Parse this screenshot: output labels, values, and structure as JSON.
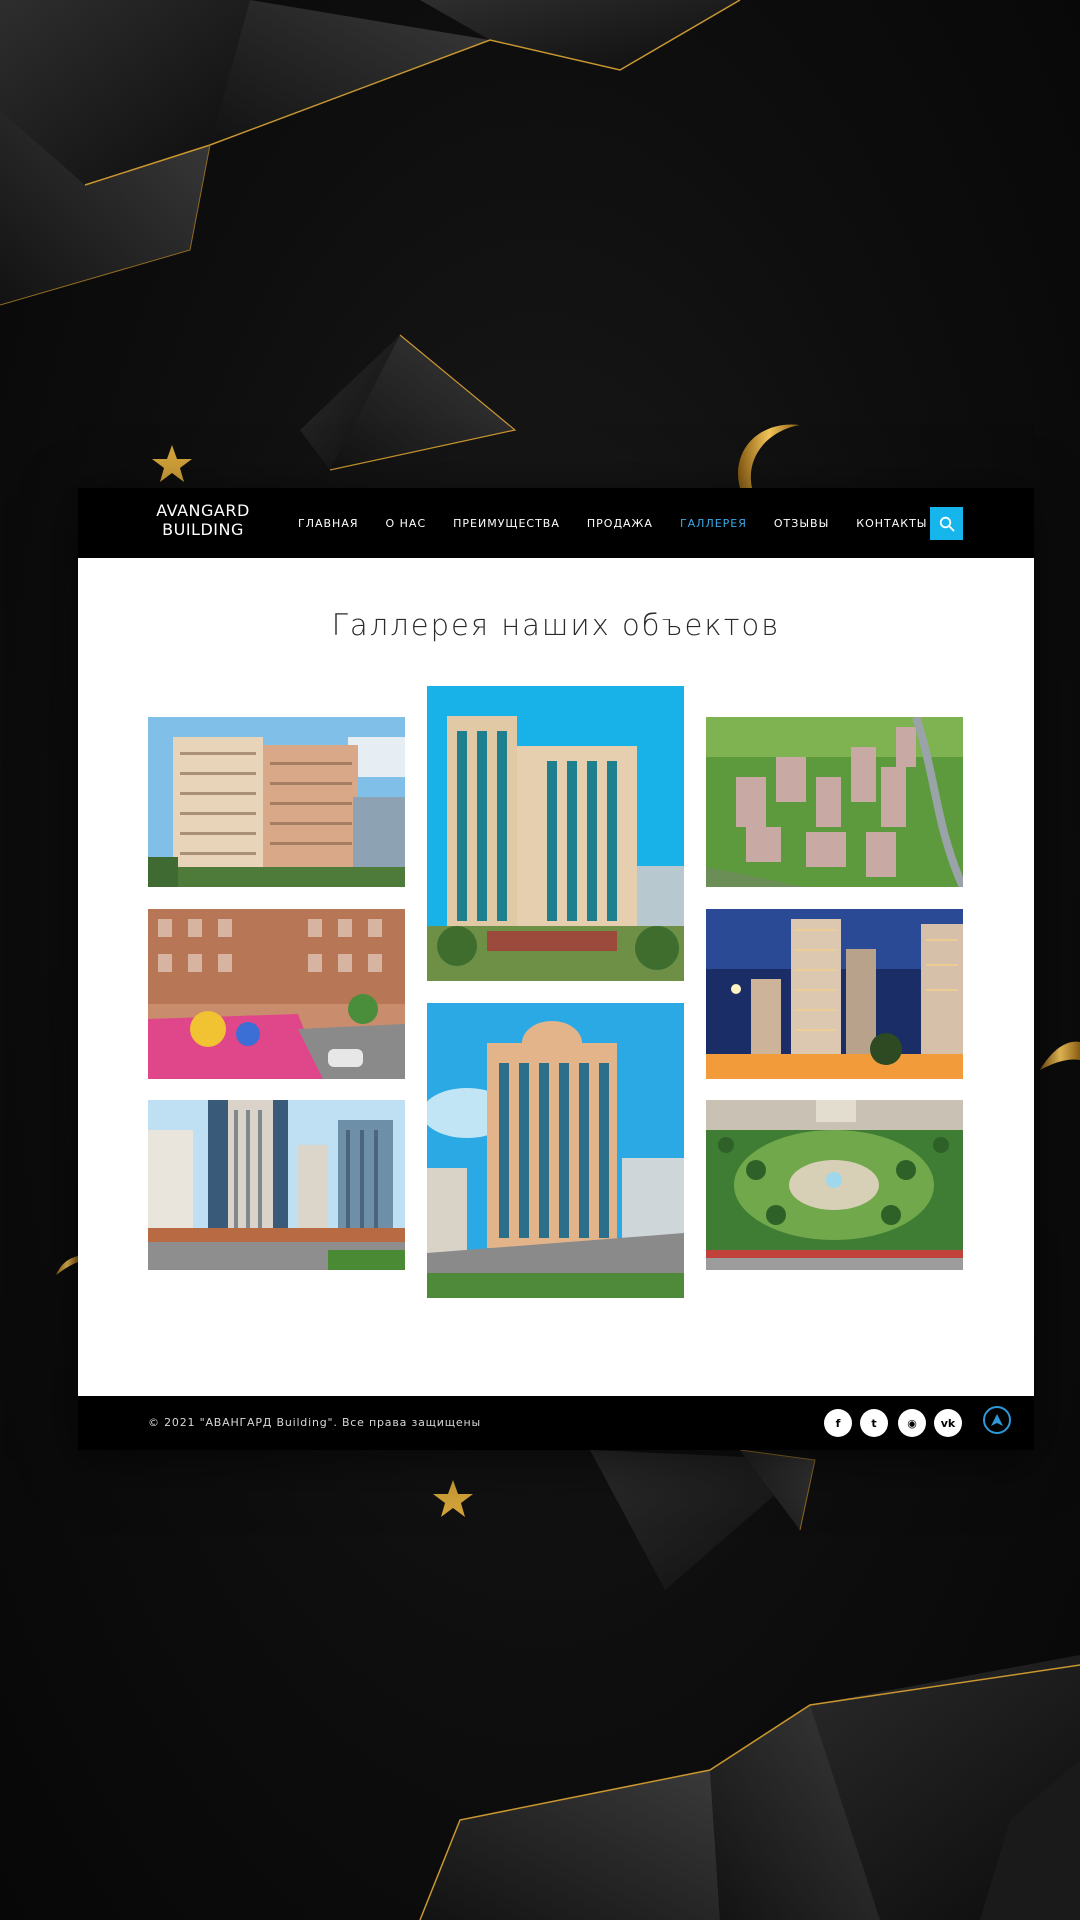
{
  "header": {
    "logo_line1": "AVANGARD",
    "logo_line2": "BUILDING",
    "nav": [
      {
        "label": "ГЛАВНАЯ"
      },
      {
        "label": "О НАС"
      },
      {
        "label": "ПРЕИМУЩЕСТВА"
      },
      {
        "label": "ПРОДАЖА"
      },
      {
        "label": "ГАЛЛЕРЕЯ",
        "active": true
      },
      {
        "label": "ОТЗЫВЫ"
      },
      {
        "label": "КОНТАКТЫ"
      }
    ],
    "search_icon": "search-icon",
    "accent_color": "#16b6ec",
    "active_color": "#3aa9e8"
  },
  "gallery": {
    "title": "Галлерея наших объектов",
    "photos": [
      "building-photo-1",
      "playground-photo",
      "street-buildings-photo",
      "tower-photo-1",
      "tower-photo-2",
      "aerial-complex-photo",
      "night-towers-photo",
      "park-aerial-photo"
    ]
  },
  "footer": {
    "copyright": "© 2021 \"АВАНГАРД Building\". Все права защищены",
    "social": [
      {
        "icon": "facebook-icon",
        "glyph": "f"
      },
      {
        "icon": "twitter-icon",
        "glyph": "t"
      },
      {
        "icon": "rss-icon",
        "glyph": "◉"
      },
      {
        "icon": "vk-icon",
        "glyph": "vk"
      }
    ],
    "scroll_top_icon": "arrow-up-icon"
  },
  "colors": {
    "background": "#0e0e0e",
    "gold": "#d4a43a",
    "navbar": "#000000"
  }
}
